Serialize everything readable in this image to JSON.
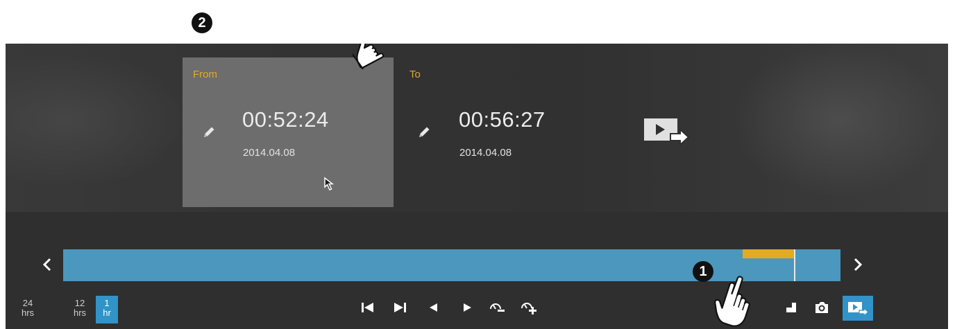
{
  "badges": {
    "one": "1",
    "two": "2"
  },
  "clip": {
    "from": {
      "label": "From",
      "time": "00:52:24",
      "date": "2014.04.08"
    },
    "to": {
      "label": "To",
      "time": "00:56:27",
      "date": "2014.04.08"
    }
  },
  "timeline": {
    "selection_fraction": [
      0.874,
      0.94
    ],
    "playhead_fraction": 0.94
  },
  "timescale": [
    {
      "value": "24",
      "unit": "hrs",
      "active": false
    },
    {
      "value": "12",
      "unit": "hrs",
      "active": false
    },
    {
      "value": "1",
      "unit": "hr",
      "active": true
    }
  ],
  "colors": {
    "accent": "#e5a82a",
    "timeline": "#4b97be",
    "active_button": "#3193c8",
    "selection": "#e3ab22"
  },
  "icons": [
    "pencil-icon",
    "export-icon",
    "skip-start-icon",
    "skip-end-icon",
    "step-back-icon",
    "play-icon",
    "speed-down-icon",
    "speed-up-icon",
    "pip-icon",
    "snapshot-icon",
    "export-clip-icon",
    "hand-pointer-icon",
    "mouse-cursor-icon"
  ]
}
